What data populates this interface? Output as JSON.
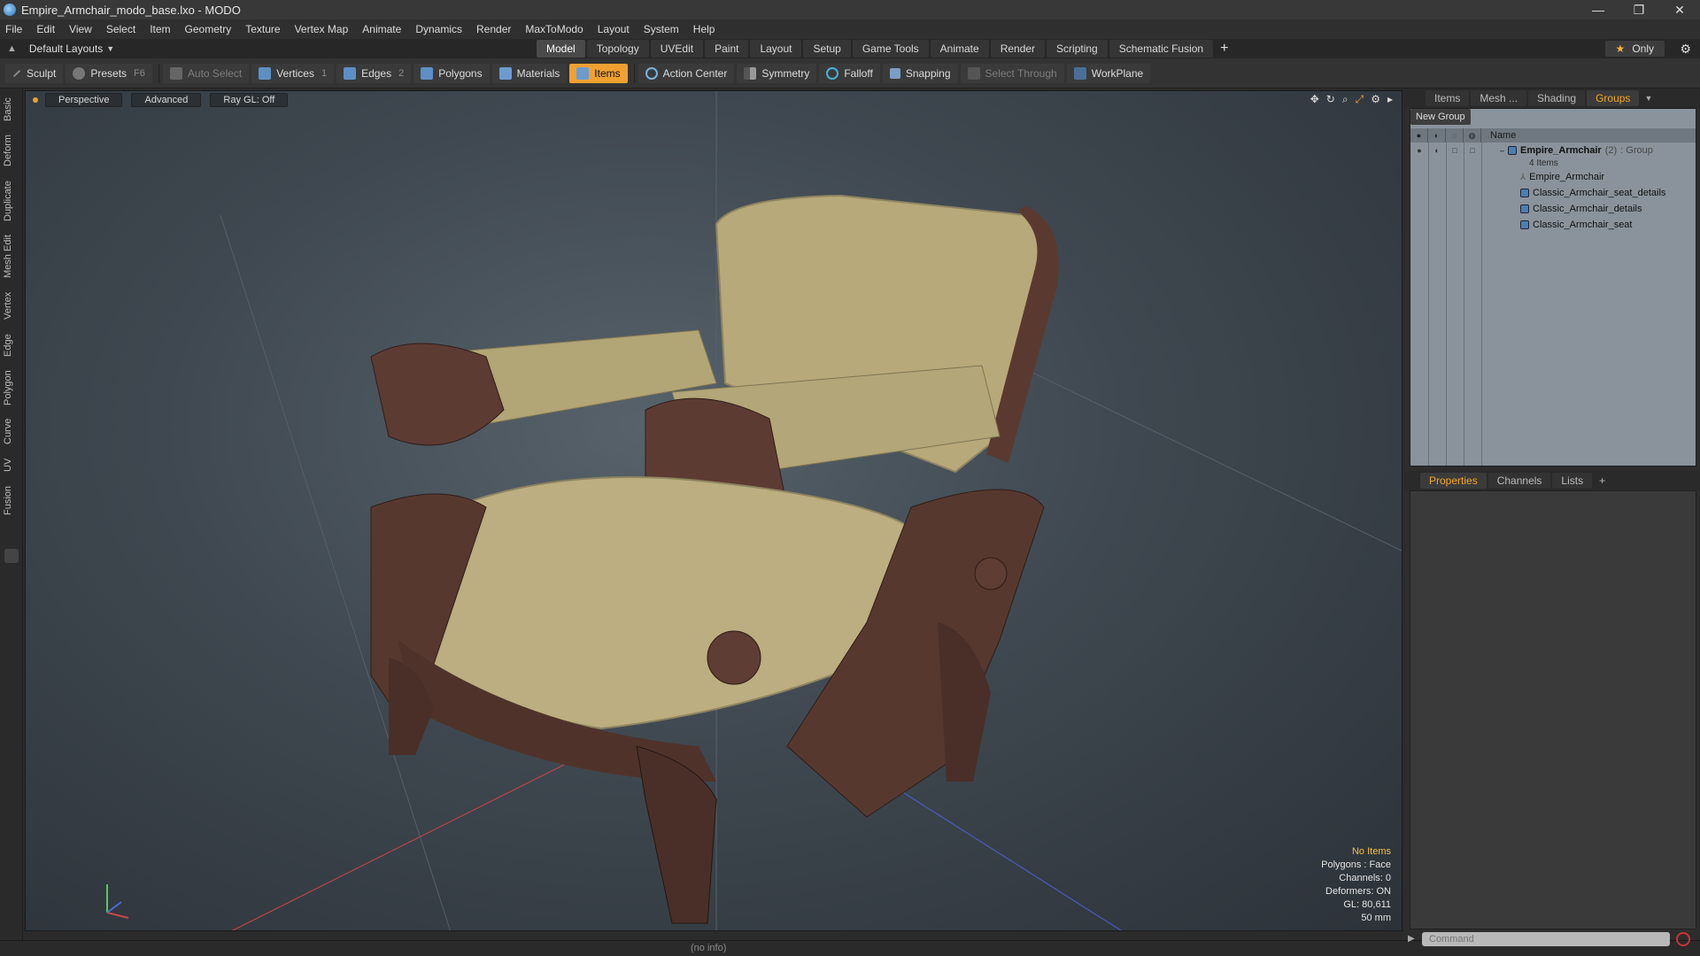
{
  "window": {
    "title": "Empire_Armchair_modo_base.lxo - MODO",
    "controls": [
      "—",
      "❐",
      "✕"
    ]
  },
  "menu": [
    "File",
    "Edit",
    "View",
    "Select",
    "Item",
    "Geometry",
    "Texture",
    "Vertex Map",
    "Animate",
    "Dynamics",
    "Render",
    "MaxToModo",
    "Layout",
    "System",
    "Help"
  ],
  "layouts": {
    "label": "Default Layouts"
  },
  "tabs": [
    "Model",
    "Topology",
    "UVEdit",
    "Paint",
    "Layout",
    "Setup",
    "Game Tools",
    "Animate",
    "Render",
    "Scripting",
    "Schematic Fusion"
  ],
  "only_label": "Only",
  "toolbar": {
    "sculpt": "Sculpt",
    "presets": "Presets",
    "presets_key": "F6",
    "auto_select": "Auto Select",
    "vertices": "Vertices",
    "vertices_key": "1",
    "edges": "Edges",
    "edges_key": "2",
    "polygons": "Polygons",
    "materials": "Materials",
    "items": "Items",
    "action_center": "Action Center",
    "symmetry": "Symmetry",
    "falloff": "Falloff",
    "snapping": "Snapping",
    "select_through": "Select Through",
    "workplane": "WorkPlane"
  },
  "left_tabs": [
    "Basic",
    "Deform",
    "Duplicate",
    "Mesh Edit",
    "Vertex",
    "Edge",
    "Polygon",
    "Curve",
    "UV",
    "Fusion"
  ],
  "viewport": {
    "perspective": "Perspective",
    "advanced": "Advanced",
    "raygl": "Ray GL: Off",
    "stats": {
      "no_items": "No Items",
      "polygons": "Polygons : Face",
      "channels": "Channels: 0",
      "deformers": "Deformers: ON",
      "gl": "GL: 80,611",
      "size": "50 mm"
    }
  },
  "right_tabs": [
    "Items",
    "Mesh ...",
    "Shading",
    "Groups"
  ],
  "groups": {
    "new_group": "New Group",
    "name_col": "Name",
    "root": {
      "name": "Empire_Armchair",
      "count": "(2)",
      "type": ": Group",
      "sub": "4 Items"
    },
    "children": [
      "Empire_Armchair",
      "Classic_Armchair_seat_details",
      "Classic_Armchair_details",
      "Classic_Armchair_seat"
    ]
  },
  "bottom_tabs": [
    "Properties",
    "Channels",
    "Lists",
    "+"
  ],
  "status": {
    "info": "(no info)",
    "command_placeholder": "Command"
  },
  "colors": {
    "accent": "#f5a623",
    "items_active": "#f0a030"
  }
}
